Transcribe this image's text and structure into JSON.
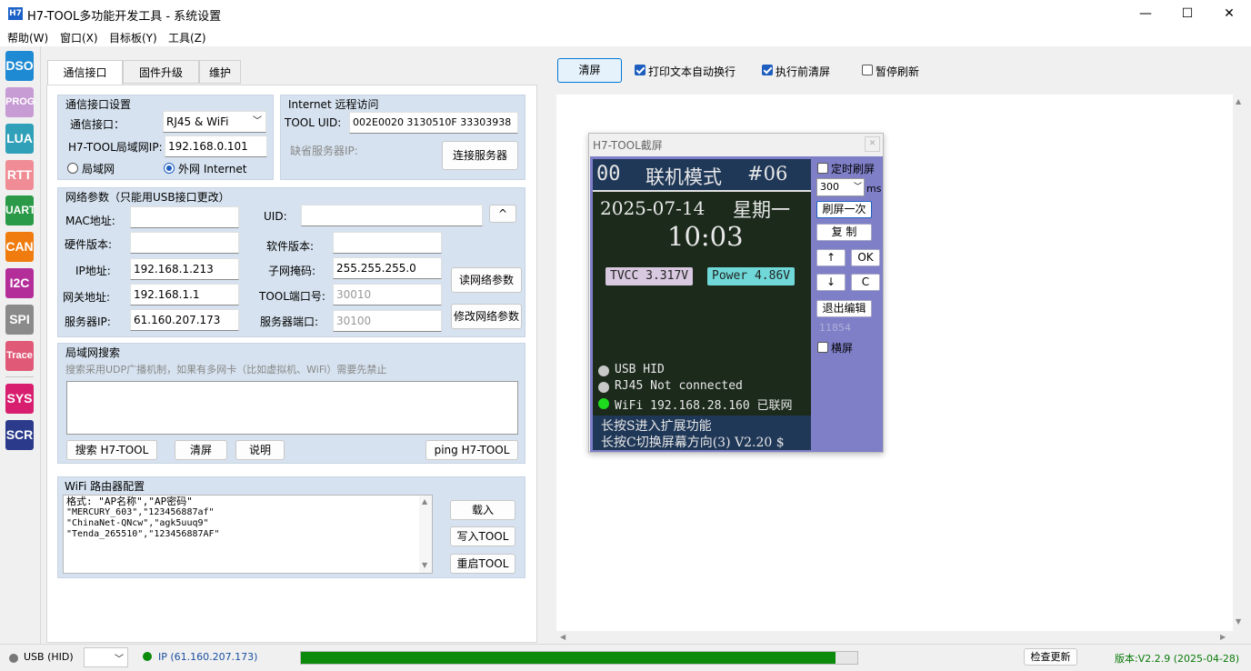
{
  "window": {
    "title": "H7-TOOL多功能开发工具 - 系统设置",
    "icon_text": "H7",
    "minimize": "—",
    "maximize": "☐",
    "close": "✕"
  },
  "menu": [
    "帮助(W)",
    "窗口(X)",
    "目标板(Y)",
    "工具(Z)"
  ],
  "sidebar": [
    {
      "label": "DSO",
      "color": "#1f8ad4"
    },
    {
      "label": "PROG",
      "color": "#c79bd4"
    },
    {
      "label": "LUA",
      "color": "#2fa0b8"
    },
    {
      "label": "RTT",
      "color": "#f08c96"
    },
    {
      "label": "UART",
      "color": "#2a9a48"
    },
    {
      "label": "CAN",
      "color": "#f07c10"
    },
    {
      "label": "I2C",
      "color": "#b42e9a"
    },
    {
      "label": "SPI",
      "color": "#8a8a8a"
    },
    {
      "label": "Trace",
      "color": "#e05a78"
    },
    {
      "label": "SYS",
      "color": "#d81e6e"
    },
    {
      "label": "SCR",
      "color": "#2b3a8a"
    }
  ],
  "tabs": [
    "通信接口",
    "固件升级",
    "维护"
  ],
  "comm": {
    "title": "通信接口设置",
    "port_label": "通信接口：",
    "port_value": "RJ45 & WiFi",
    "lan_ip_label": "H7-TOOL局域网IP:",
    "lan_ip_value": "192.168.0.101",
    "radio_lan": "局域网",
    "radio_wan": "外网 Internet"
  },
  "internet": {
    "title": "Internet 远程访问",
    "uid_label": "TOOL UID:",
    "uid_value": "002E0020 3130510F 33303938",
    "server_ip_label": "缺省服务器IP:",
    "connect_btn": "连接服务器"
  },
  "net": {
    "title": "网络参数（只能用USB接口更改）",
    "mac_label": "MAC地址:",
    "mac_value": "",
    "uid_label": "UID:",
    "uid_value": "",
    "caret_btn": "^",
    "hw_label": "硬件版本:",
    "hw_value": "",
    "sw_label": "软件版本:",
    "sw_value": "",
    "ip_label": "IP地址:",
    "ip_value": "192.168.1.213",
    "mask_label": "子网掩码:",
    "mask_value": "255.255.255.0",
    "gw_label": "网关地址:",
    "gw_value": "192.168.1.1",
    "port_label": "TOOL端口号:",
    "port_value": "30010",
    "srv_ip_label": "服务器IP:",
    "srv_ip_value": "61.160.207.173",
    "srv_port_label": "服务器端口:",
    "srv_port_value": "30100",
    "read_btn": "读网络参数",
    "modify_btn": "修改网络参数"
  },
  "lan_search": {
    "title": "局域网搜索",
    "hint": "搜索采用UDP广播机制，如果有多网卡（比如虚拟机、WiFi）需要先禁止",
    "search_btn": "搜索 H7-TOOL",
    "clear_btn": "清屏",
    "help_btn": "说明",
    "ping_btn": "ping H7-TOOL"
  },
  "wifi": {
    "title": "WiFi 路由器配置",
    "lines": [
      "格式: \"AP名称\",\"AP密码\"",
      "\"MERCURY_603\",\"123456887af\"",
      "\"ChinaNet-QNcw\",\"agk5uuq9\"",
      "\"Tenda_265510\",\"123456887AF\""
    ],
    "load_btn": "载入",
    "write_btn": "写入TOOL",
    "restart_btn": "重启TOOL"
  },
  "toolbar": {
    "clear_btn": "清屏",
    "wrap_label": "打印文本自动换行",
    "wrap_checked": true,
    "clear_before_label": "执行前清屏",
    "clear_before_checked": true,
    "pause_label": "暂停刷新",
    "pause_checked": false
  },
  "screenshot_win": {
    "title": "H7-TOOL截屏",
    "close": "✕",
    "screen": {
      "top_num": "00",
      "mode": "联机模式",
      "channel": "#06",
      "date": "2025-07-14",
      "weekday": "星期一",
      "time": "10:03",
      "tvcc": "TVCC 3.317V",
      "power": "Power 4.86V",
      "usb": "USB HID",
      "rj45": "RJ45 Not connected",
      "wifi": "WiFi 192.168.28.160 已联网",
      "hint1": "长按S进入扩展功能",
      "hint2": "长按C切换屏幕方向(3)  V2.20 $"
    },
    "timer_label": "定时刷屏",
    "interval": "300",
    "unit": "ms",
    "refresh_btn": "刷屏一次",
    "copy_btn": "复 制",
    "up_btn": "↑",
    "ok_btn": "OK",
    "down_btn": "↓",
    "c_btn": "C",
    "exit_btn": "退出编辑",
    "counter": "11854",
    "landscape_label": "横屏"
  },
  "status": {
    "usb": "USB (HID)",
    "ip": "IP (61.160.207.173)",
    "progress": 0.96,
    "update_btn": "检查更新",
    "version": "版本:V2.2.9 (2025-04-28)",
    "colors": {
      "ok": "#0b8a0b",
      "idle": "#777777",
      "version": "#0a7a0a"
    }
  }
}
